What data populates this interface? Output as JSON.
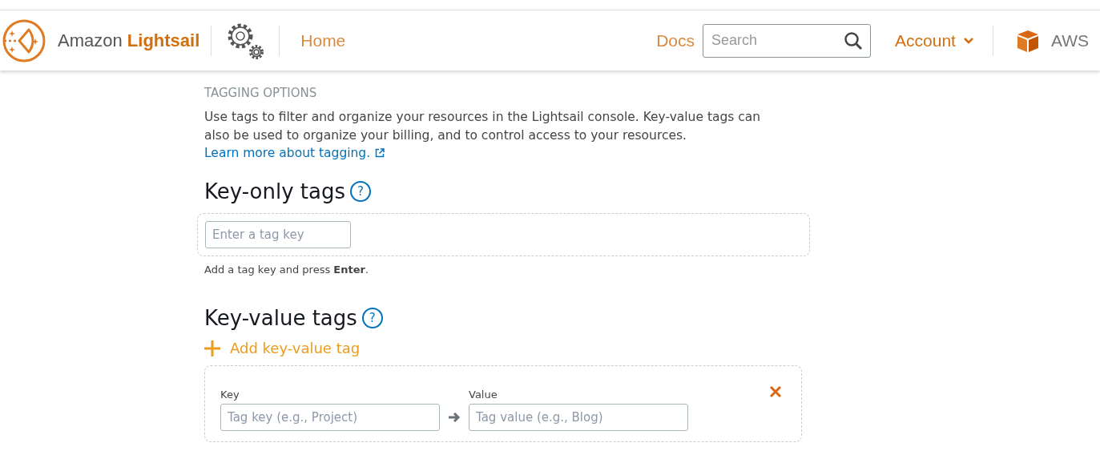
{
  "header": {
    "brand_plain": "Amazon ",
    "brand_bold": "Lightsail",
    "nav": [
      {
        "label": "Home"
      }
    ],
    "docs": "Docs",
    "search": {
      "placeholder": "Search"
    },
    "account": "Account",
    "aws": "AWS"
  },
  "section_label": "TAGGING OPTIONS",
  "intro": "Use tags to filter and organize your resources in the Lightsail console. Key-value tags can also be used to organize your billing, and to control access to your resources.",
  "learn_more": "Learn more about tagging.",
  "key_only": {
    "title": "Key-only tags",
    "help": "?",
    "input": {
      "placeholder": "Enter a tag key"
    },
    "hint": "Add a tag key and press **Enter**."
  },
  "key_value": {
    "title": "Key-value tags",
    "help": "?",
    "add": "Add key-value tag",
    "rows": [
      {
        "key_label": "Key",
        "key_placeholder": "Tag key (e.g., Project)",
        "value_label": "Value",
        "value_placeholder": "Tag value (e.g., Blog)"
      }
    ]
  }
}
